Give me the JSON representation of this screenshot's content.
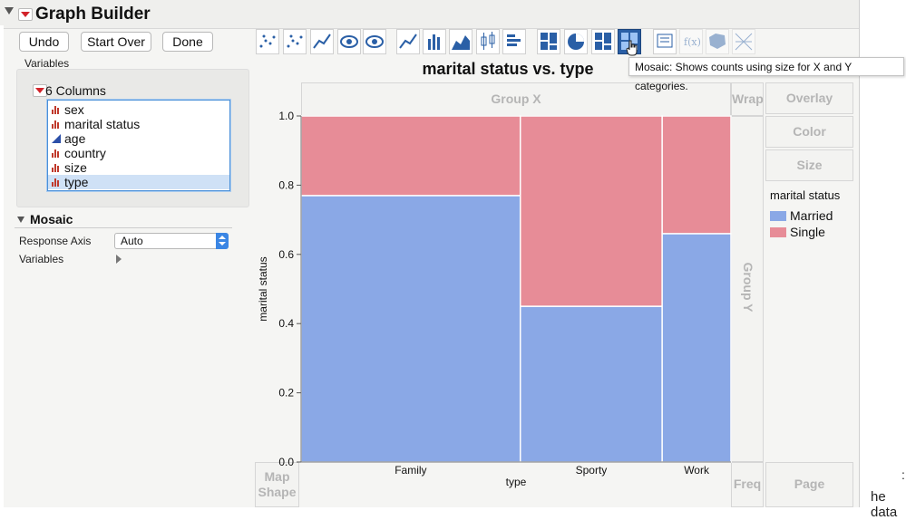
{
  "app": {
    "title": "Graph Builder"
  },
  "toolbar": {
    "undo": "Undo",
    "start_over": "Start Over",
    "done": "Done"
  },
  "variables_panel": {
    "label": "Variables",
    "columns_title": "6 Columns",
    "columns": [
      {
        "name": "sex",
        "type": "nominal"
      },
      {
        "name": "marital status",
        "type": "nominal"
      },
      {
        "name": "age",
        "type": "continuous"
      },
      {
        "name": "country",
        "type": "nominal"
      },
      {
        "name": "size",
        "type": "nominal"
      },
      {
        "name": "type",
        "type": "nominal",
        "selected": true
      }
    ]
  },
  "mosaic_section": {
    "title": "Mosaic",
    "response_axis_label": "Response Axis",
    "response_axis_value": "Auto",
    "variables_label": "Variables"
  },
  "graph_type_icons": [
    "points-icon",
    "smoother-icon",
    "line-of-fit-icon",
    "ellipse-icon",
    "contour-icon",
    "line-icon",
    "bar-icon",
    "area-icon",
    "box-plot-icon",
    "histogram-icon",
    "heatmap-icon",
    "pie-icon",
    "treemap-icon",
    "mosaic-icon",
    "caption-box-icon",
    "formula-icon",
    "map-shapes-icon",
    "parallel-plot-icon"
  ],
  "tooltip": "Mosaic: Shows counts using size for X and Y categories.",
  "drop_zones": {
    "group_x": "Group X",
    "group_y": "Group Y",
    "wrap": "Wrap",
    "overlay": "Overlay",
    "color": "Color",
    "size": "Size",
    "map_shape": "Map\nShape",
    "freq": "Freq",
    "page": "Page"
  },
  "colors": {
    "married": "#8aa8e6",
    "single": "#e78c97",
    "accent": "#2a5fa6"
  },
  "outside_text": "he data",
  "chart_data": {
    "type": "mosaic",
    "title": "marital status vs. type",
    "xlabel": "type",
    "ylabel": "marital status",
    "categories": [
      "Family",
      "Sporty",
      "Work"
    ],
    "widths": [
      0.51,
      0.33,
      0.16
    ],
    "series": [
      {
        "name": "Married",
        "values": [
          0.77,
          0.45,
          0.66
        ]
      },
      {
        "name": "Single",
        "values": [
          0.23,
          0.55,
          0.34
        ]
      }
    ],
    "yticks": [
      "0.0",
      "0.2",
      "0.4",
      "0.6",
      "0.8",
      "1.0"
    ],
    "ylim": [
      0,
      1
    ],
    "legend": {
      "title": "marital status",
      "entries": [
        "Married",
        "Single"
      ],
      "position": "right"
    }
  }
}
